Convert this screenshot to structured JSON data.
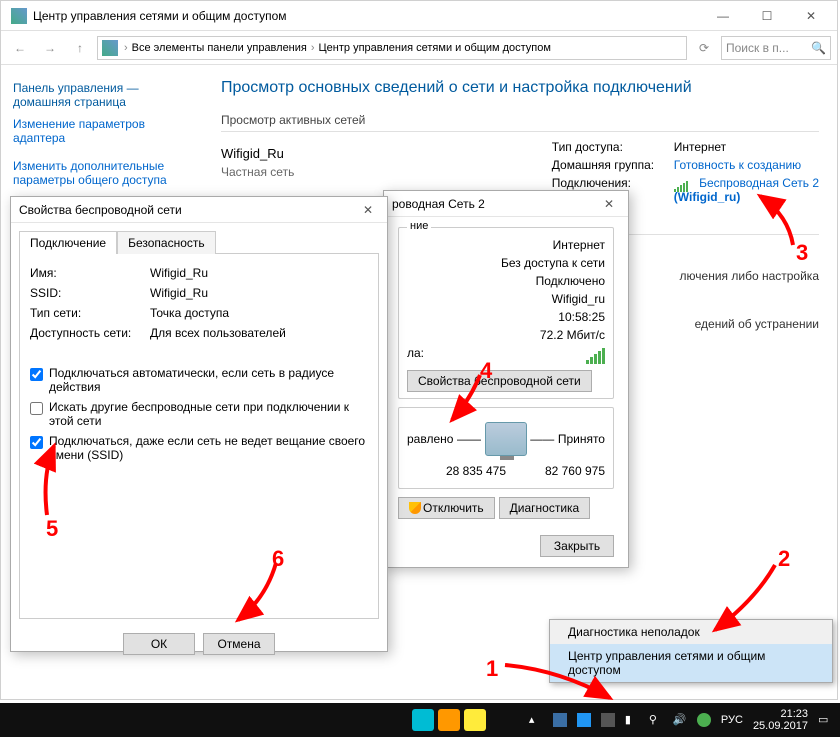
{
  "window": {
    "title": "Центр управления сетями и общим доступом",
    "breadcrumb": {
      "p1": "Все элементы панели управления",
      "p2": "Центр управления сетями и общим доступом"
    },
    "search_placeholder": "Поиск в п..."
  },
  "sidebar": {
    "heading": "Панель управления — домашняя страница",
    "link1": "Изменение параметров адаптера",
    "link2": "Изменить дополнительные параметры общего доступа"
  },
  "main": {
    "heading": "Просмотр основных сведений о сети и настройка подключений",
    "active_label": "Просмотр активных сетей",
    "net_name": "Wifigid_Ru",
    "net_type": "Частная сеть",
    "access_k": "Тип доступа:",
    "access_v": "Интернет",
    "home_k": "Домашняя группа:",
    "home_v": "Готовность к созданию",
    "conn_k": "Подключения:",
    "conn_v1": "Беспроводная Сеть 2",
    "conn_v2": "(Wifigid_ru)",
    "extra1": "лючения либо настройка",
    "extra2": "едений об устранении"
  },
  "status": {
    "title": "роводная Сеть 2",
    "grp1": "ние",
    "ipv4": "Интернет",
    "ipv6": "Без доступа к сети",
    "state": "Подключено",
    "ssid": "Wifigid_ru",
    "dur": "10:58:25",
    "speed": "72.2 Мбит/с",
    "signal_label": "ла:",
    "props_btn": "Свойства беспроводной сети",
    "sent_label": "равлено",
    "recv_label": "Принято",
    "sent": "28 835 475",
    "recv": "82 760 975",
    "disable_btn": "Отключить",
    "diag_btn": "Диагностика",
    "close_btn": "Закрыть"
  },
  "props": {
    "title": "Свойства беспроводной сети",
    "tab1": "Подключение",
    "tab2": "Безопасность",
    "name_k": "Имя:",
    "name_v": "Wifigid_Ru",
    "ssid_k": "SSID:",
    "ssid_v": "Wifigid_Ru",
    "type_k": "Тип сети:",
    "type_v": "Точка доступа",
    "avail_k": "Доступность сети:",
    "avail_v": "Для всех пользователей",
    "chk1": "Подключаться автоматически, если сеть в радиусе действия",
    "chk2": "Искать другие беспроводные сети при подключении к этой сети",
    "chk3": "Подключаться, даже если сеть не ведет вещание своего имени (SSID)",
    "ok": "ОК",
    "cancel": "Отмена"
  },
  "ctx": {
    "mi1": "Диагностика неполадок",
    "mi2": "Центр управления сетями и общим доступом"
  },
  "tray": {
    "lang": "РУС",
    "time": "21:23",
    "date": "25.09.2017"
  },
  "ann": {
    "n1": "1",
    "n2": "2",
    "n3": "3",
    "n4": "4",
    "n5": "5",
    "n6": "6"
  }
}
